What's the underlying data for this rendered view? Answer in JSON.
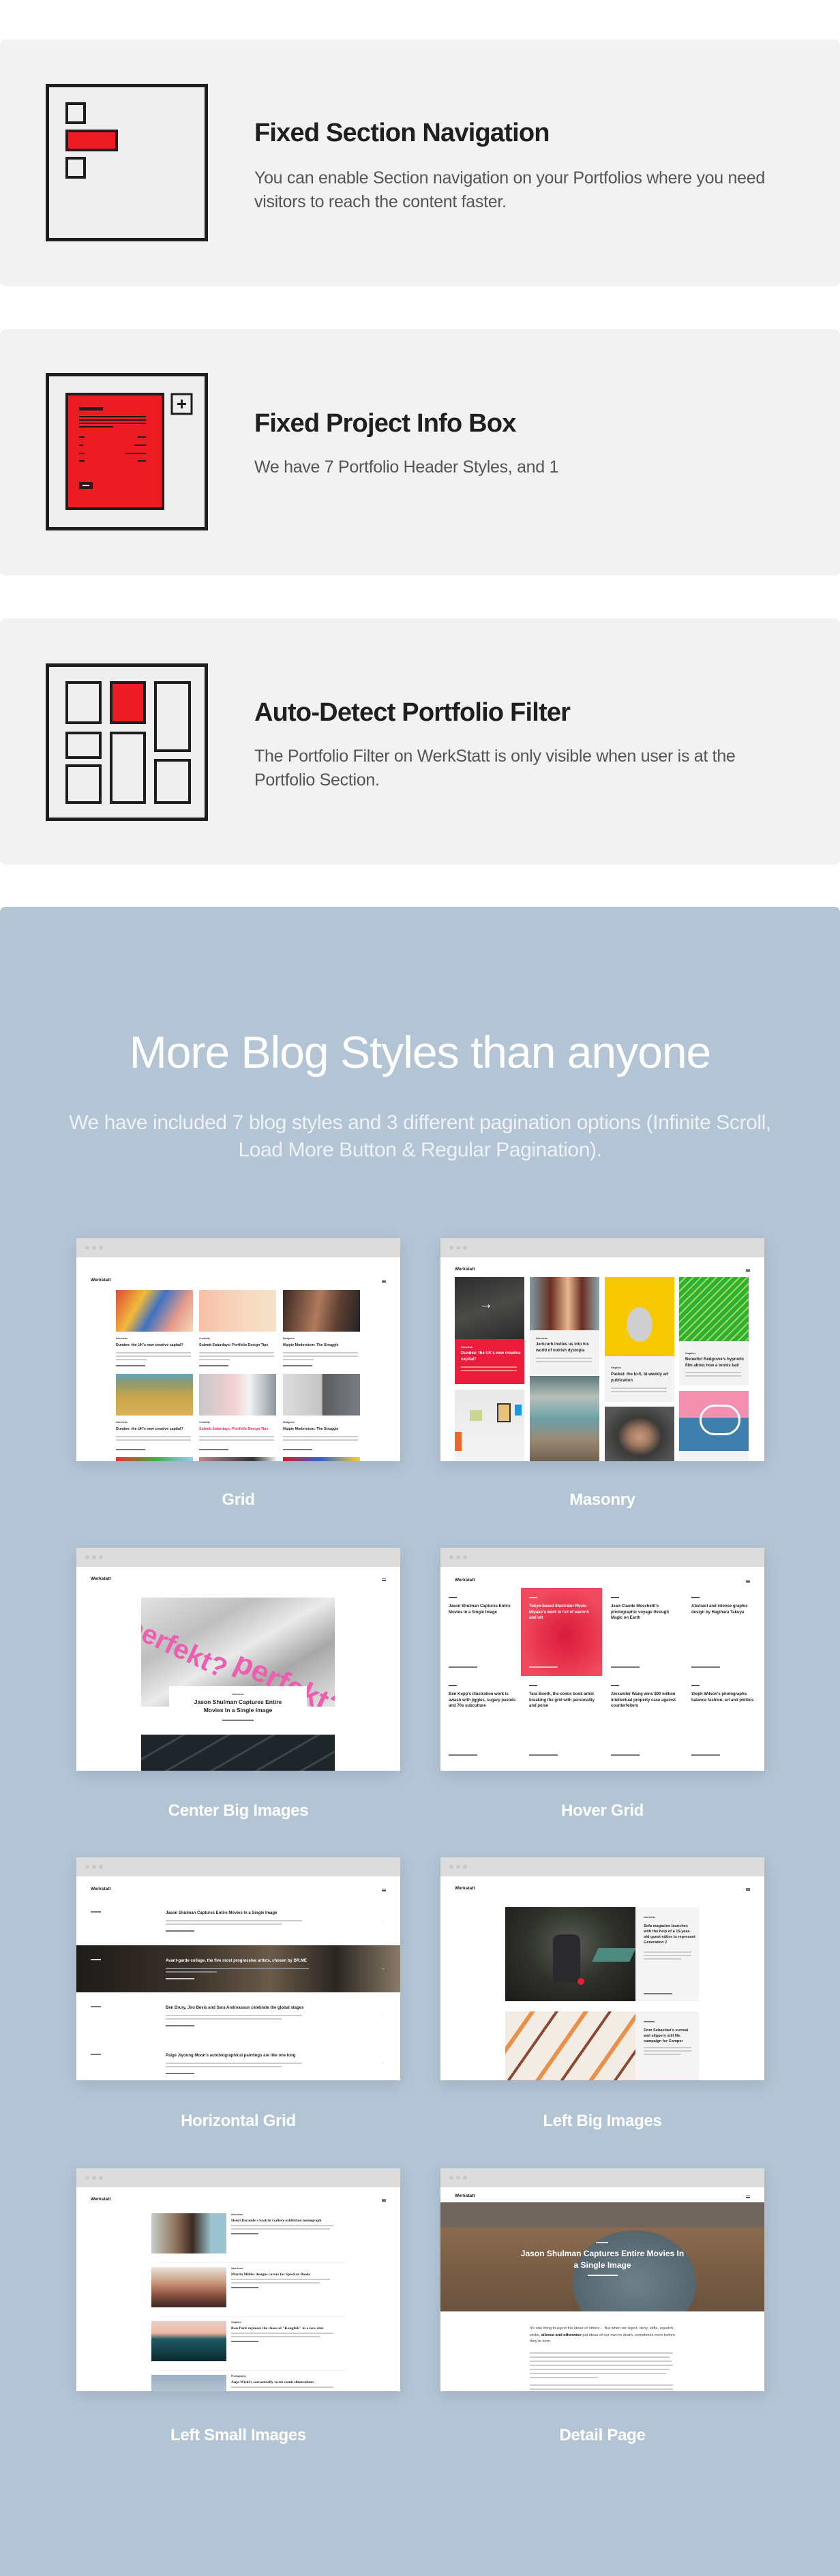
{
  "colors": {
    "accent_red": "#ed1c24",
    "card_bg": "#f2f2f2",
    "section_blue": "#b3c5d5"
  },
  "features": [
    {
      "icon": "section-navigation-icon",
      "title": "Fixed Section Navigation",
      "description": "You can enable Section navigation on your Portfolios where you need visitors to reach the content faster."
    },
    {
      "icon": "project-info-box-icon",
      "title": "Fixed Project Info Box",
      "description": "We have 7 Portfolio Header Styles, and 1"
    },
    {
      "icon": "portfolio-filter-icon",
      "title": "Auto-Detect Portfolio Filter",
      "description": "The Portfolio Filter on WerkStatt is only visible when user is at the Portfolio Section."
    }
  ],
  "blog": {
    "title": "More Blog Styles than anyone",
    "subtitle": "We have included 7 blog styles and 3 different pagination options (Infinite Scroll, Load More Button & Regular Pagination).",
    "site_name": "Werkstatt",
    "styles": [
      {
        "label": "Grid"
      },
      {
        "label": "Masonry"
      },
      {
        "label": "Center Big Images"
      },
      {
        "label": "Hover Grid"
      },
      {
        "label": "Horizontal Grid"
      },
      {
        "label": "Left Big Images"
      },
      {
        "label": "Left Small Images"
      },
      {
        "label": "Detail Page"
      }
    ],
    "grid": {
      "posts": [
        {
          "category": "Interviews",
          "title": "Dundee: the UK's new creative capital?"
        },
        {
          "category": "Creativity",
          "title": "Submit Saturdays: Portfolio Design Tips"
        },
        {
          "category": "Designers",
          "title": "Hippie Modernism: The Struggle"
        },
        {
          "category": "Interviews",
          "title": "Dundee: the UK's new creative capital?"
        },
        {
          "category": "Creativity",
          "title": "Submit Saturdays: Portfolio Design Tips"
        },
        {
          "category": "Designers",
          "title": "Hippie Modernism: The Struggle"
        }
      ]
    },
    "masonry": {
      "posts": [
        {
          "category": "Interviews",
          "title": "Dundee: the UK's new creative capital?"
        },
        {
          "category": "Interviews",
          "title": "Jerkcurb invites us into his world of noirish dystopia"
        },
        {
          "category": "Graphics",
          "title": "Packet: the lo-fi, bi-weekly art publication"
        },
        {
          "category": "Graphics",
          "title": "Benedict Redgrove's hypnotic film about how a tennis ball"
        }
      ]
    },
    "center_big": {
      "category": "Interviews",
      "title": "Jason Shulman Captures Entire Movies In a Single Image",
      "image_text": "perfekt?"
    },
    "hover_grid": {
      "posts": [
        {
          "title": "Jason Shulman Captures Entire Movies In a Single Image"
        },
        {
          "title": "Tokyo-based illustrator Ryuto Miyake's work is full of warmth and wit"
        },
        {
          "title": "Jean-Claude Moschetti's photographic voyage through Magic on Earth"
        },
        {
          "title": "Abstract and intense graphic design by Hagihara Takuya"
        },
        {
          "title": "Ben Kopp's illustration work is awash with jiggles, sugary pastels and 70s subculture"
        },
        {
          "title": "Tara Booth, the comic book artist breaking the grid with personality and poise"
        },
        {
          "title": "Alexander Wang wins $90 million intellectual property case against counterfeiters"
        },
        {
          "title": "Steph Wilson's photographs balance fashion, art and politics"
        }
      ]
    },
    "horizontal": {
      "posts": [
        {
          "title": "Jason Shulman Captures Entire Movies In a Single Image"
        },
        {
          "title": "Avant-garde collage, the five most progressive artists, chosen by DR.ME"
        },
        {
          "title": "Ben Drury, Jiro Bevis and Sara Andreasson celebrate the global stages"
        },
        {
          "title": "Paige Jiyoung Moon's autobiographical paintings are like one long"
        }
      ]
    },
    "left_big": {
      "posts": [
        {
          "category": "Interviews",
          "title": "Sofa magazine launches with the help of a 15-year-old guest editor to represent Generation Z"
        },
        {
          "category": "Interviews",
          "title": "Dom Sebastian's surreal and slippery still life campaign for Camper"
        }
      ]
    },
    "left_small": {
      "posts": [
        {
          "category": "Interviews",
          "title": "Henri Barande's Saatchi Gallery exhibition monograph"
        },
        {
          "category": "Interviews",
          "title": "Martin Müller designs covers for Speckan Books"
        },
        {
          "category": "Graphics",
          "title": "Ran Park explores the chaos of \"Konglish\" in a new zine"
        },
        {
          "category": "Photography",
          "title": "Anja Wicki's sarcastically sweet comic illustrations"
        }
      ]
    },
    "detail": {
      "title": "Jason Shulman Captures Entire Movies In a Single Image",
      "intro_start": "It's one thing to reject the ideas of others… But when we reject, deny, stifle, squelch, strike, ",
      "intro_bold": "silence and otherwise",
      "intro_end": " put ideas of our own to death, sometimes even before they're born."
    }
  }
}
